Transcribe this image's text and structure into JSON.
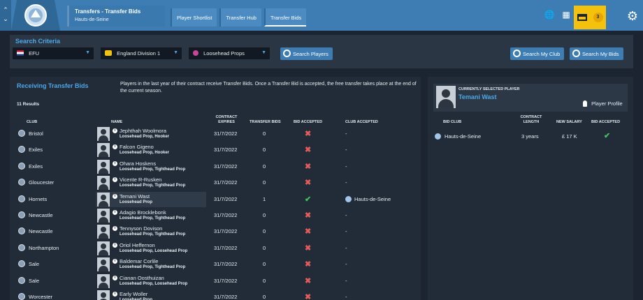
{
  "header": {
    "title": "Transfers - Transfer Bids",
    "subtitle": "Hauts-de-Seine",
    "tabs": [
      "Player Shortlist",
      "Transfer Hub",
      "Transfer Bids"
    ],
    "active_tab": 2,
    "mail_count": "3",
    "accent": "#3d7db3"
  },
  "criteria": {
    "label": "Search Criteria",
    "dropdowns": [
      "EFU",
      "England Division 1",
      "Loosehead Props"
    ],
    "search_players": "Search Players",
    "search_my_club": "Search My Club",
    "search_my_bids": "Search My Bids"
  },
  "left": {
    "title": "Receiving Transfer Bids",
    "info": "Players in the last year of their contract receive Transfer Bids.  Once a Transfer Bid is accepted, the free transfer takes place at the end of the current season.",
    "results": "11 Results",
    "columns": {
      "club": "CLUB",
      "name": "NAME",
      "expires": "CONTRACT EXPIRES",
      "bids": "TRANSFER BIDS",
      "accepted": "BID ACCEPTED",
      "club_accepted": "CLUB ACCEPTED"
    },
    "rows": [
      {
        "club": "Bristol",
        "name": "Jephthah Woolmora",
        "pos": "Loosehead Prop, Hooker",
        "expires": "31/7/2022",
        "bids": "0",
        "accepted": "✖",
        "club_accepted": "-"
      },
      {
        "club": "Exiles",
        "name": "Falcon Gigeno",
        "pos": "Loosehead Prop, Hooker",
        "expires": "31/7/2022",
        "bids": "0",
        "accepted": "✖",
        "club_accepted": "-"
      },
      {
        "club": "Exiles",
        "name": "Ohara Hoskens",
        "pos": "Loosehead Prop, Tighthead Prop",
        "expires": "31/7/2022",
        "bids": "0",
        "accepted": "✖",
        "club_accepted": "-"
      },
      {
        "club": "Gloucester",
        "name": "Vicente R-Rusken",
        "pos": "Loosehead Prop, Tighthead Prop",
        "expires": "31/7/2022",
        "bids": "0",
        "accepted": "✖",
        "club_accepted": "-"
      },
      {
        "club": "Hornets",
        "name": "Temani Wast",
        "pos": "Loosehead Prop",
        "expires": "31/7/2022",
        "bids": "1",
        "accepted": "✔",
        "club_accepted": "Hauts-de-Seine"
      },
      {
        "club": "Newcastle",
        "name": "Adagio Brocklebonk",
        "pos": "Loosehead Prop, Tighthead Prop",
        "expires": "31/7/2022",
        "bids": "0",
        "accepted": "✖",
        "club_accepted": "-"
      },
      {
        "club": "Newcastle",
        "name": "Tennyson Dovison",
        "pos": "Loosehead Prop, Tighthead Prop",
        "expires": "31/7/2022",
        "bids": "0",
        "accepted": "✖",
        "club_accepted": "-"
      },
      {
        "club": "Northampton",
        "name": "Oriol Heffernon",
        "pos": "Loosehead Prop, Loosehead Prop",
        "expires": "31/7/2022",
        "bids": "0",
        "accepted": "✖",
        "club_accepted": "-"
      },
      {
        "club": "Sale",
        "name": "Baldemar Corlile",
        "pos": "Loosehead Prop, Tighthead Prop",
        "expires": "31/7/2022",
        "bids": "0",
        "accepted": "✖",
        "club_accepted": "-"
      },
      {
        "club": "Sale",
        "name": "Cianan Oosthuizan",
        "pos": "Loosehead Prop, Loosehead Prop",
        "expires": "31/7/2022",
        "bids": "0",
        "accepted": "✖",
        "club_accepted": "-"
      },
      {
        "club": "Worcester",
        "name": "Early Woller",
        "pos": "Loosehead Prop",
        "expires": "31/7/2022",
        "bids": "0",
        "accepted": "✖",
        "club_accepted": "-"
      }
    ]
  },
  "right": {
    "selected_label": "CURRENTLY SELECTED PLAYER",
    "selected_name": "Temani Wast",
    "profile": "Player Profile",
    "columns": {
      "bid_club": "BID CLUB",
      "length": "CONTRACT LENGTH",
      "salary": "NEW SALARY",
      "accepted": "BID ACCEPTED"
    },
    "bid": {
      "club": "Hauts-de-Seine",
      "length": "3 years",
      "salary": "£ 17 K",
      "accepted": "✔"
    }
  }
}
